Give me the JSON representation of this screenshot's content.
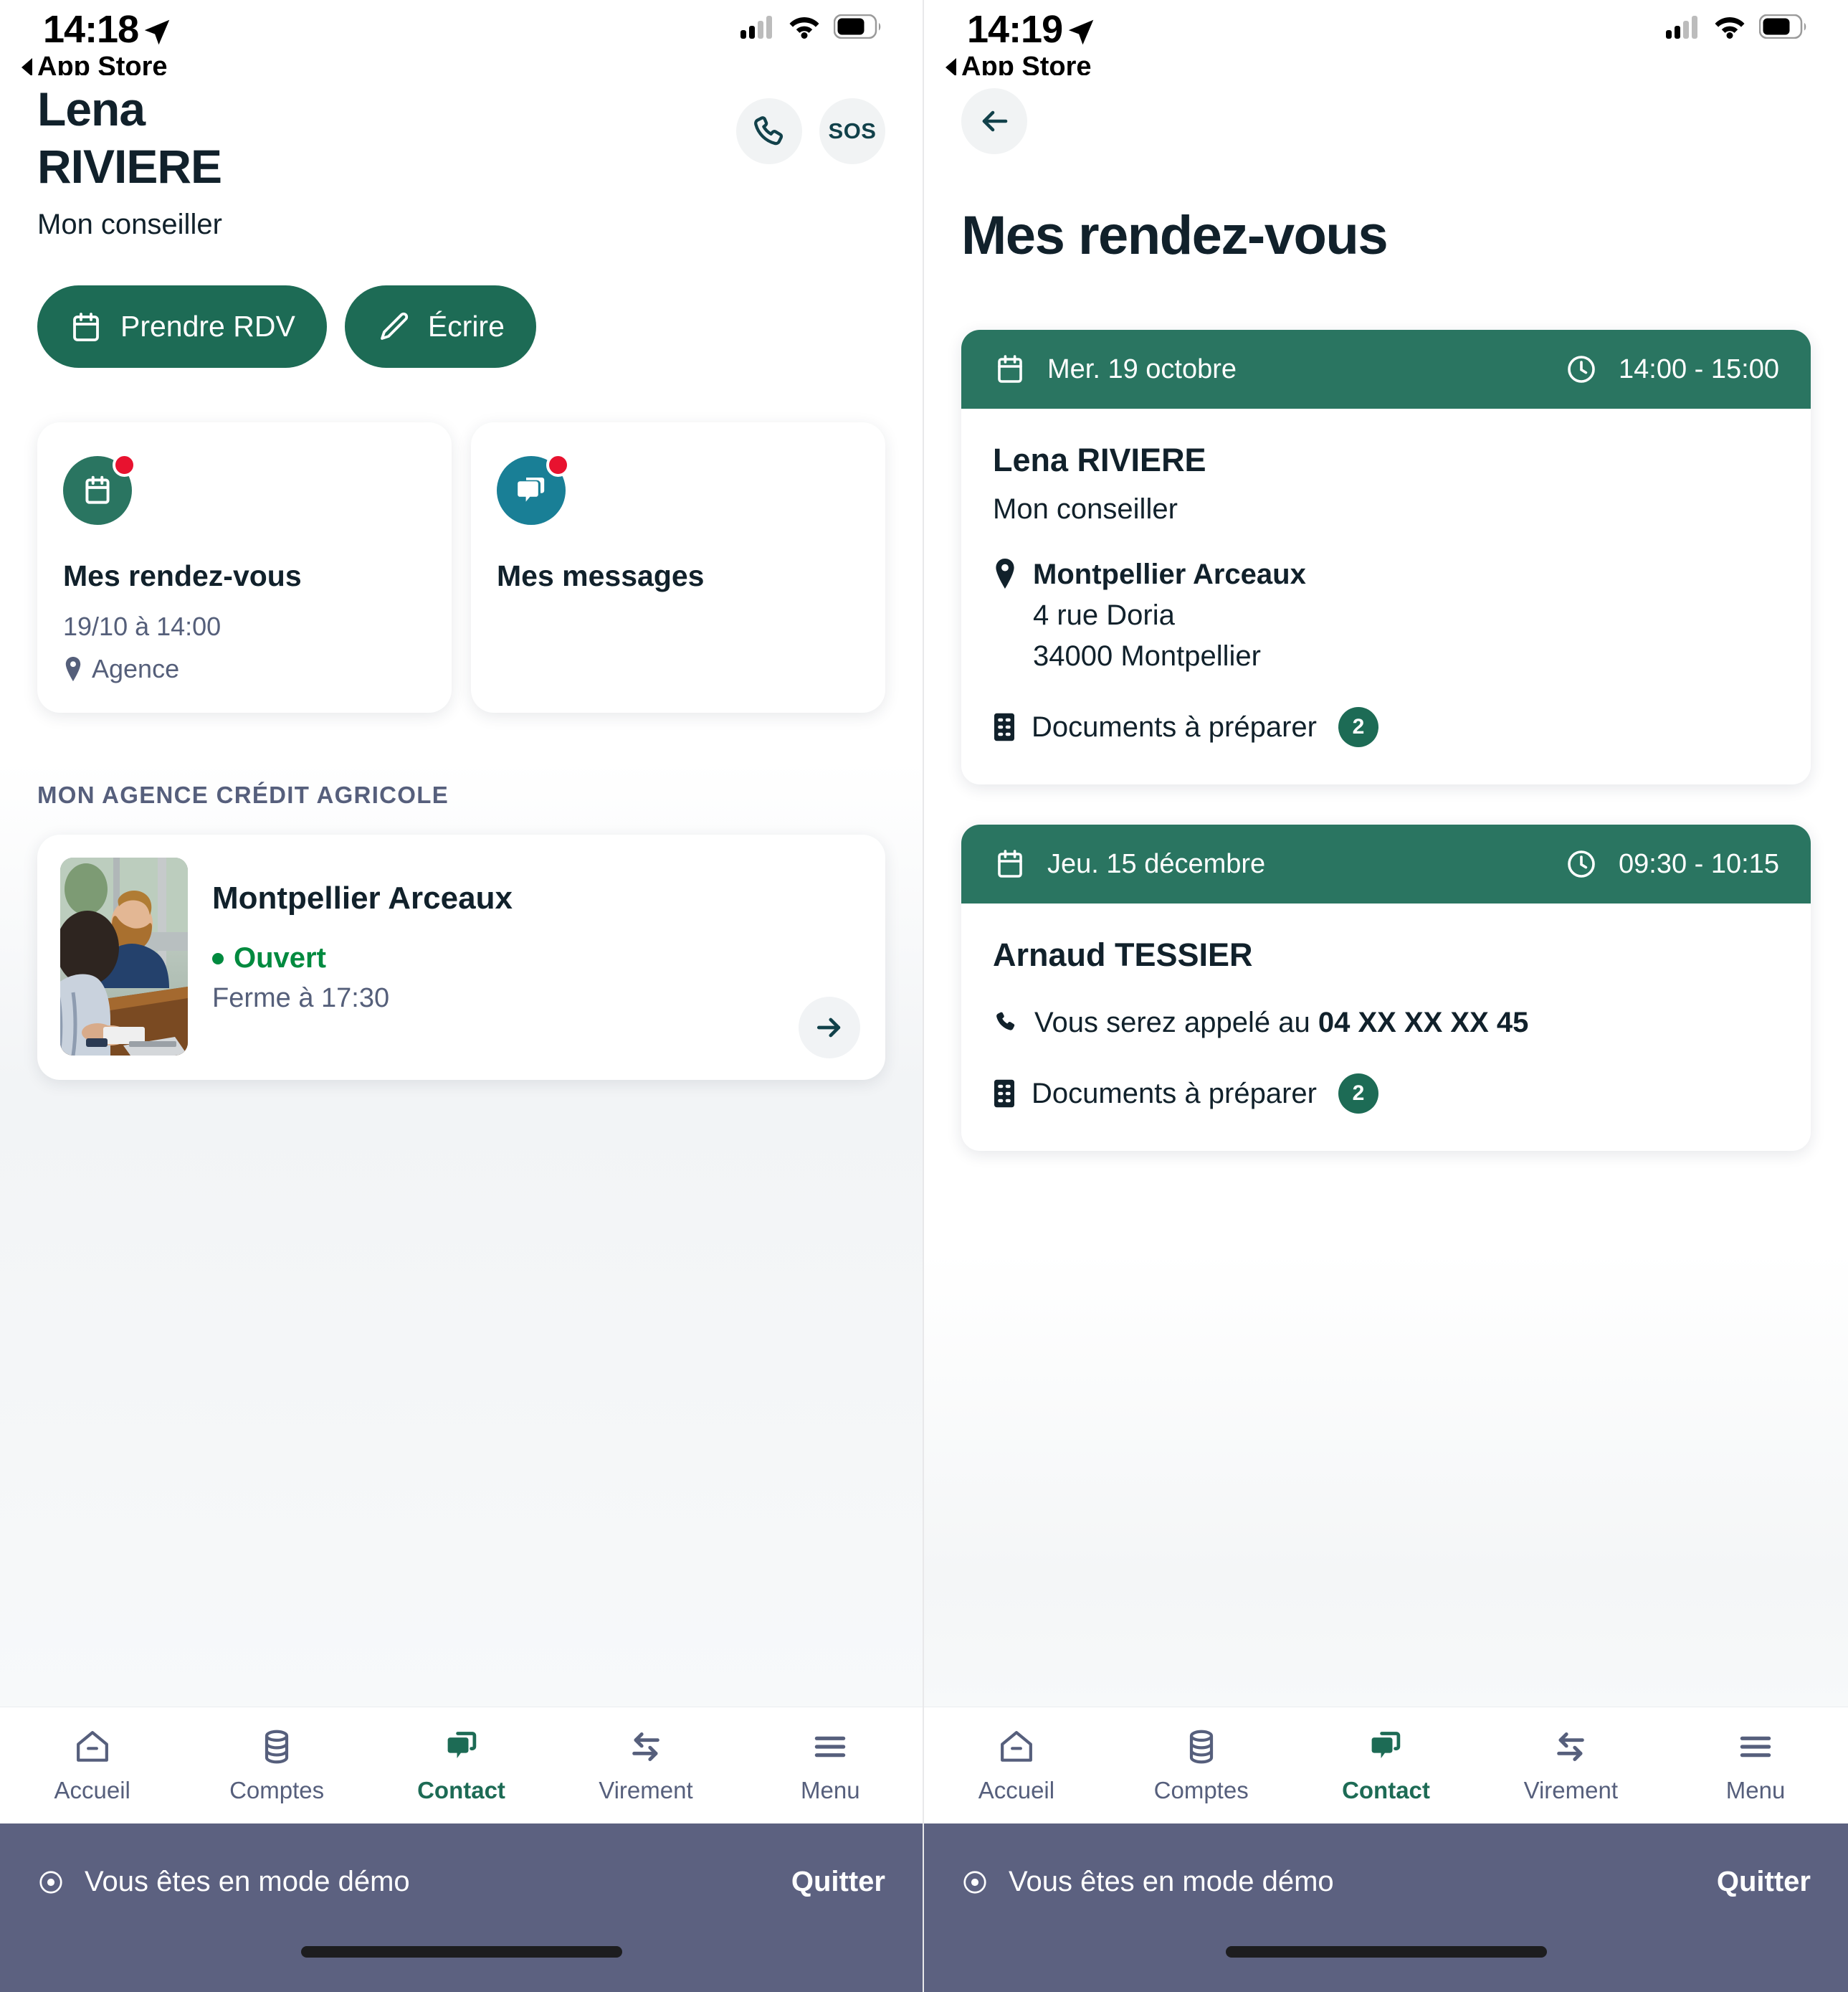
{
  "left_screen": {
    "status_bar": {
      "time": "14:18",
      "back_label": "App Store",
      "location_icon": "location-arrow-icon",
      "cellular_icon": "cellular-signal-icon",
      "wifi_icon": "wifi-icon",
      "battery_icon": "battery-icon"
    },
    "advisor": {
      "first_name": "Lena",
      "last_name": "RIVIERE",
      "role": "Mon conseiller",
      "call_icon": "phone-icon",
      "sos_label": "SOS"
    },
    "actions": [
      {
        "label": "Prendre RDV",
        "icon": "calendar-icon"
      },
      {
        "label": "Écrire",
        "icon": "pencil-icon"
      }
    ],
    "tiles": [
      {
        "title": "Mes rendez-vous",
        "subtitle": "19/10 à 14:00",
        "location": "Agence",
        "icon": "calendar-icon",
        "icon_color": "#2a7561",
        "has_notification": true
      },
      {
        "title": "Mes messages",
        "subtitle": "",
        "location": "",
        "icon": "chat-bubbles-icon",
        "icon_color": "#197f96",
        "has_notification": true
      }
    ],
    "agency_section": {
      "label": "MON AGENCE CRÉDIT AGRICOLE",
      "name": "Montpellier Arceaux",
      "status": "Ouvert",
      "status_color": "#008a3f",
      "hours": "Ferme à 17:30",
      "go_icon": "arrow-right-icon",
      "photo_alt": "advisor-meeting-photo"
    }
  },
  "right_screen": {
    "status_bar": {
      "time": "14:19",
      "back_label": "App Store",
      "location_icon": "location-arrow-icon",
      "cellular_icon": "cellular-signal-icon",
      "wifi_icon": "wifi-icon",
      "battery_icon": "battery-icon"
    },
    "back_icon": "arrow-left-icon",
    "title": "Mes rendez-vous",
    "appointments": [
      {
        "date": "Mer. 19 octobre",
        "time": "14:00 - 15:00",
        "person": "Lena RIVIERE",
        "role": "Mon conseiller",
        "place": "Montpellier Arceaux",
        "address_line1": "4 rue Doria",
        "address_line2": "34000 Montpellier",
        "phone_prefix": "",
        "phone_number": "",
        "documents_label": "Documents à préparer",
        "documents_count": "2",
        "date_icon": "calendar-icon",
        "time_icon": "clock-icon",
        "place_icon": "map-pin-icon",
        "documents_icon": "document-icon"
      },
      {
        "date": "Jeu. 15 décembre",
        "time": "09:30 - 10:15",
        "person": "Arnaud TESSIER",
        "role": "",
        "place": "",
        "address_line1": "",
        "address_line2": "",
        "phone_prefix": "Vous serez appelé au ",
        "phone_number": "04 XX XX XX 45",
        "documents_label": "Documents à préparer",
        "documents_count": "2",
        "date_icon": "calendar-icon",
        "time_icon": "clock-icon",
        "place_icon": "phone-icon",
        "documents_icon": "document-icon"
      }
    ]
  },
  "tabbar": {
    "items": [
      {
        "label": "Accueil",
        "icon": "home-icon",
        "active": false
      },
      {
        "label": "Comptes",
        "icon": "coins-icon",
        "active": false
      },
      {
        "label": "Contact",
        "icon": "chat-icon",
        "active": true
      },
      {
        "label": "Virement",
        "icon": "transfer-icon",
        "active": false
      },
      {
        "label": "Menu",
        "icon": "hamburger-icon",
        "active": false
      }
    ]
  },
  "demo_bar": {
    "icon": "info-circle-icon",
    "text": "Vous êtes en mode démo",
    "quit_label": "Quitter"
  },
  "colors": {
    "brand_green": "#1d6b55",
    "header_green": "#2a7561",
    "teal": "#197f96",
    "notification_red": "#e8122f",
    "open_green": "#008a3f",
    "slate": "#565f7c",
    "demo_bar": "#5c6180",
    "ink": "#11212b"
  }
}
